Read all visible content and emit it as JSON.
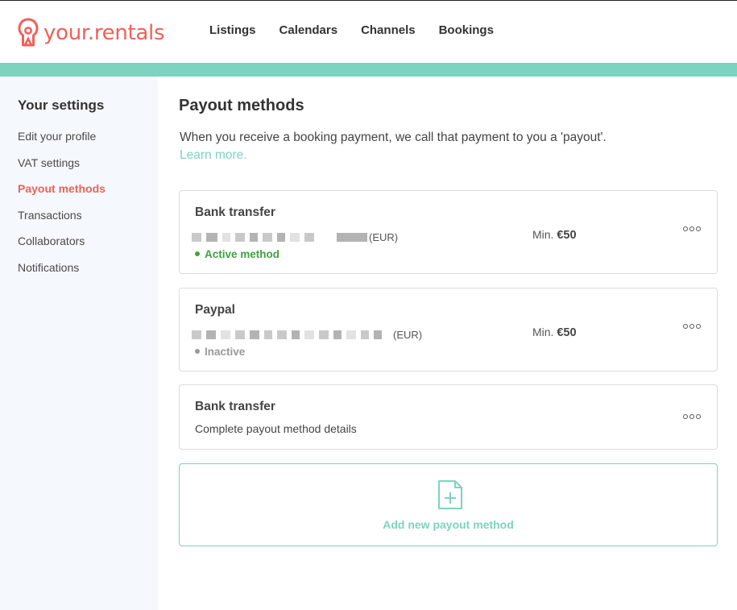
{
  "brand": {
    "name": "your.rentals",
    "color": "#f0605a",
    "accent": "#7dd3bf"
  },
  "nav": {
    "items": [
      "Listings",
      "Calendars",
      "Channels",
      "Bookings"
    ]
  },
  "sidebar": {
    "title": "Your settings",
    "items": [
      {
        "label": "Edit your profile",
        "active": false
      },
      {
        "label": "VAT settings",
        "active": false
      },
      {
        "label": "Payout methods",
        "active": true
      },
      {
        "label": "Transactions",
        "active": false
      },
      {
        "label": "Collaborators",
        "active": false
      },
      {
        "label": "Notifications",
        "active": false
      }
    ]
  },
  "main": {
    "title": "Payout methods",
    "intro": "When you receive a booking payment, we call that payment to you a 'payout'.",
    "learn_more": "Learn more.",
    "methods": [
      {
        "title": "Bank transfer",
        "currency": "(EUR)",
        "min_label": "Min.",
        "min_value": "€50",
        "status": "Active method"
      },
      {
        "title": "Paypal",
        "currency": "(EUR)",
        "min_label": "Min.",
        "min_value": "€50",
        "status": "Inactive"
      },
      {
        "title": "Bank transfer",
        "subtitle": "Complete payout method details"
      }
    ],
    "add_label": "Add new payout method",
    "icons": {
      "more": "more-dots-icon",
      "add": "add-file-icon"
    }
  }
}
